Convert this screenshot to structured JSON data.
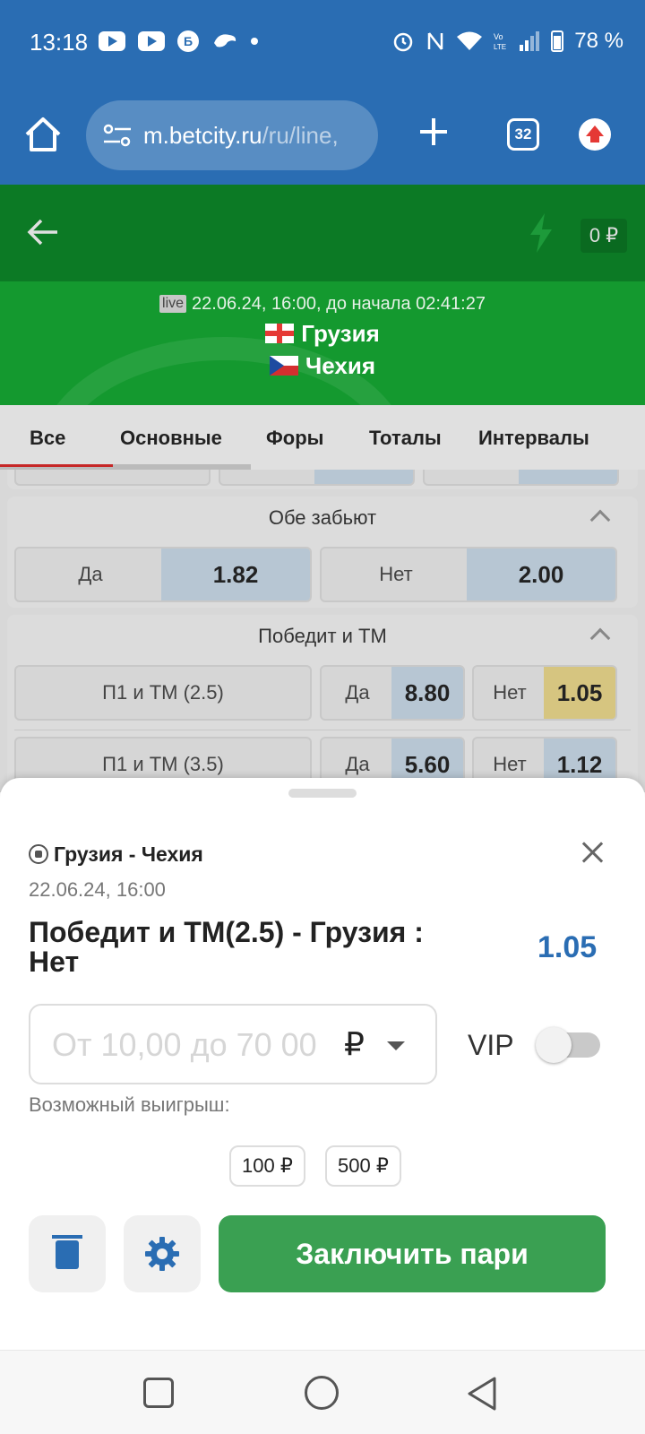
{
  "status_bar": {
    "time": "13:18",
    "battery": "78 %",
    "icons": [
      "youtube-icon",
      "youtube-icon",
      "b-icon",
      "bird-icon",
      "dot-icon",
      "alarm-icon",
      "nfc-icon",
      "wifi-icon",
      "volte-icon",
      "signal-icon",
      "battery-icon"
    ]
  },
  "browser": {
    "url_host": "m.betcity.ru",
    "url_path": "/ru/line,",
    "tabs_count": "32"
  },
  "header": {
    "balance": "0 ₽"
  },
  "match": {
    "live_badge": "live",
    "datetime": "22.06.24, 16:00, до начала  02:41:27",
    "team1": "Грузия",
    "team2": "Чехия"
  },
  "market_tabs": [
    "Все",
    "Основные",
    "Форы",
    "Тоталы",
    "Интервалы"
  ],
  "markets": {
    "both_score": {
      "title": "Обе забьют",
      "outcomes": [
        {
          "label": "Да",
          "odd": "1.82"
        },
        {
          "label": "Нет",
          "odd": "2.00"
        }
      ]
    },
    "win_total": {
      "title": "Победит и ТМ",
      "rows": [
        {
          "name": "П1 и ТМ (2.5)",
          "yes_label": "Да",
          "yes_odd": "8.80",
          "no_label": "Нет",
          "no_odd": "1.05"
        },
        {
          "name": "П1 и ТМ (3.5)",
          "yes_label": "Да",
          "yes_odd": "5.60",
          "no_label": "Нет",
          "no_odd": "1.12"
        }
      ]
    }
  },
  "betslip": {
    "event": "Грузия - Чехия",
    "date": "22.06.24,  16:00",
    "bet_name": "Победит и ТМ(2.5) - Грузия : Нет",
    "odd": "1.05",
    "stake_placeholder": "От 10,00 до 70 00",
    "currency": "₽",
    "vip_label": "VIP",
    "possible_win_label": "Возможный выигрыш:",
    "quick_amounts": [
      "100 ₽",
      "500 ₽"
    ],
    "submit_label": "Заключить пари"
  },
  "colors": {
    "browser_blue": "#2a6db3",
    "header_green": "#0c7a25",
    "match_green": "#14992f",
    "submit_green": "#3aa052",
    "odd_blue": "#2a6db3",
    "selected_odd": "#d6c580"
  }
}
